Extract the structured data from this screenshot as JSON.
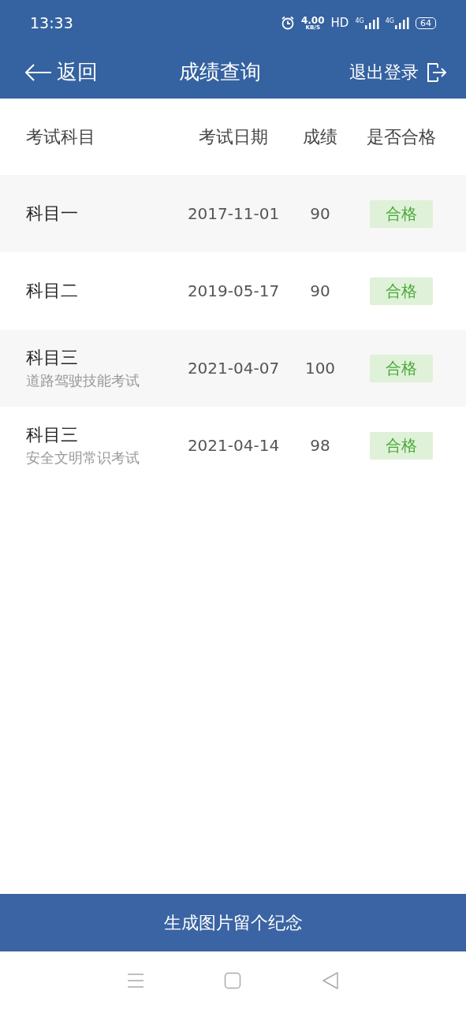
{
  "status_bar": {
    "time": "13:33",
    "speed": "4.00",
    "speed_unit": "KB/S",
    "hd": "HD",
    "networks": [
      "4G",
      "4G"
    ],
    "battery": "64"
  },
  "header": {
    "back": "返回",
    "title": "成绩查询",
    "logout": "退出登录"
  },
  "table": {
    "columns": [
      "考试科目",
      "考试日期",
      "成绩",
      "是否合格"
    ],
    "rows": [
      {
        "subject": "科目一",
        "date": "2017-11-01",
        "score": "90",
        "result": "合格"
      },
      {
        "subject": "科目二",
        "date": "2019-05-17",
        "score": "90",
        "result": "合格"
      },
      {
        "subject": "科目三",
        "note": "道路驾驶技能考试",
        "date": "2021-04-07",
        "score": "100",
        "result": "合格"
      },
      {
        "subject": "科目三",
        "note": "安全文明常识考试",
        "date": "2021-04-14",
        "score": "98",
        "result": "合格"
      }
    ]
  },
  "footer_button": "生成图片留个纪念"
}
